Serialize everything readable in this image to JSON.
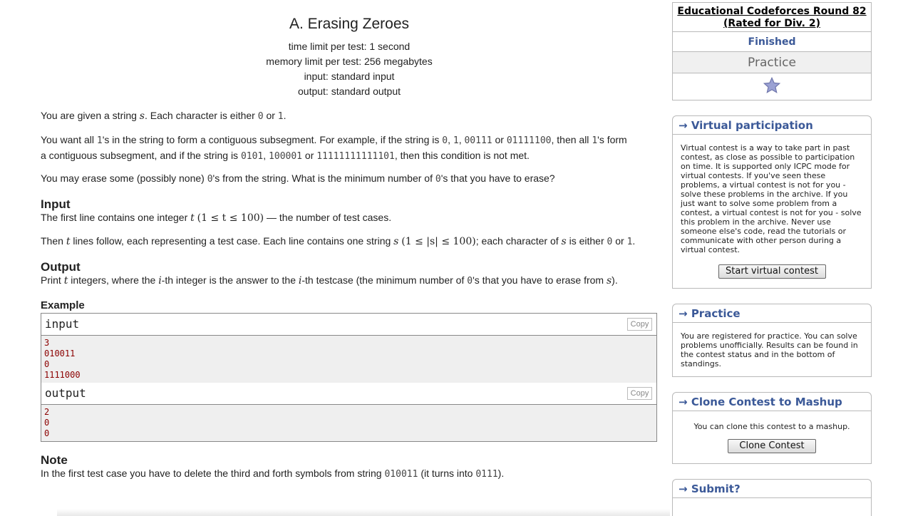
{
  "problem": {
    "title": "A. Erasing Zeroes",
    "time_limit": "time limit per test: 1 second",
    "memory_limit": "memory limit per test: 256 megabytes",
    "input_type": "input: standard input",
    "output_type": "output: standard output",
    "statement": {
      "p1_a": "You are given a string ",
      "var_s": "s",
      "p1_b": ". Each character is either ",
      "zero": "0",
      "or": " or ",
      "one": "1",
      "period": ".",
      "p2_a": "You want all ",
      "p2_b": "'s in the string to form a contiguous subsegment. For example, if the string is ",
      "ex_0": "0",
      "comma": ", ",
      "ex_1": "1",
      "ex_00111": "00111",
      "ex_01111100": "01111100",
      "p2_c": ", then all ",
      "p2_d": "'s form",
      "p2_e": "a contiguous subsegment, and if the string is ",
      "ex_0101": "0101",
      "ex_100001": "100001",
      "ex_111": "11111111111101",
      "p2_f": ", then this condition is not met.",
      "p3_a": "You may erase some (possibly none) ",
      "p3_b": "'s from the string. What is the minimum number of ",
      "p3_c": "'s that you have to erase?"
    },
    "input_section": {
      "title": "Input",
      "l1_a": "The first line contains one integer ",
      "var_t": "t",
      "l1_formula": "(1 ≤ t ≤ 100)",
      "l1_b": " — the number of test cases.",
      "l2_a": "Then ",
      "l2_b": " lines follow, each representing a test case. Each line contains one string ",
      "l2_formula": "(1 ≤ |s| ≤ 100)",
      "l2_c": "; each character of ",
      "l2_d": " is either ",
      "l2_e": "."
    },
    "output_section": {
      "title": "Output",
      "a": "Print ",
      "b": " integers, where the ",
      "var_i": "i",
      "c": "-th integer is the answer to the ",
      "d": "-th testcase (the minimum number of ",
      "e": "'s that you have to erase from ",
      "f": ")."
    },
    "example": {
      "title": "Example",
      "input_label": "input",
      "output_label": "output",
      "copy_label": "Copy",
      "input_lines": [
        "3",
        "010011",
        "0",
        "1111000"
      ],
      "output_lines": [
        "2",
        "0",
        "0"
      ]
    },
    "note": {
      "title": "Note",
      "a": "In the first test case you have to delete the third and forth symbols from string ",
      "code1": "010011",
      "b": " (it turns into ",
      "code2": "0111",
      "c": ")."
    }
  },
  "sidebar": {
    "contest_name": "Educational Codeforces Round 82 (Rated for Div. 2)",
    "status": "Finished",
    "practice": "Practice",
    "virtual": {
      "title": "Virtual participation",
      "text": "Virtual contest is a way to take part in past contest, as close as possible to participation on time. It is supported only ICPC mode for virtual contests. If you've seen these problems, a virtual contest is not for you - solve these problems in the archive. If you just want to solve some problem from a contest, a virtual contest is not for you - solve this problem in the archive. Never use someone else's code, read the tutorials or communicate with other person during a virtual contest.",
      "button": "Start virtual contest"
    },
    "practice_box": {
      "title": "Practice",
      "text": "You are registered for practice. You can solve problems unofficially. Results can be found in the contest status and in the bottom of standings."
    },
    "clone": {
      "title": "Clone Contest to Mashup",
      "text": "You can clone this contest to a mashup.",
      "button": "Clone Contest"
    },
    "submit": {
      "title": "Submit?"
    },
    "arrow": "→"
  },
  "colors": {
    "accent": "#3b5998",
    "sample_text": "#8b0000",
    "sample_bg": "#efefef",
    "star": "#9aa1d3"
  }
}
